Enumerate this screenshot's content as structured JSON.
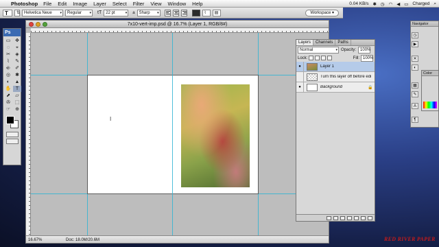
{
  "menubar": {
    "apple": "",
    "app_name": "Photoshop",
    "items": [
      "File",
      "Edit",
      "Image",
      "Layer",
      "Select",
      "Filter",
      "View",
      "Window",
      "Help"
    ],
    "battery_values": "0.04 KB/s",
    "charged": "Charged"
  },
  "options_bar": {
    "tool_glyph": "T",
    "font_family": "Helvetica Neue",
    "font_style": "Regular",
    "font_size": "22 pt",
    "aa_label": "a",
    "antialias": "Sharp",
    "workspace": "Workspace"
  },
  "tools": {
    "header": "Ps",
    "glyphs": [
      "▭",
      "✥",
      "◌",
      "⌖",
      "✂",
      "◈",
      "⌇",
      "✎",
      "⎆",
      "✐",
      "◎",
      "✱",
      "◐",
      "▲",
      "✋",
      "⬚",
      "T",
      "⬈",
      "▱",
      "✇",
      "☞",
      "⊕"
    ]
  },
  "document": {
    "title": "7x10-vert-imp.psd @ 16.7% (Layer 1, RGB/8#)",
    "zoom": "16.67%",
    "doc_size": "Doc: 18.0M/20.6M"
  },
  "layers_panel": {
    "tabs": [
      "Layers",
      "Channels",
      "Paths"
    ],
    "blend_mode": "Normal",
    "opacity_label": "Opacity:",
    "opacity_value": "100%",
    "lock_label": "Lock:",
    "fill_label": "Fill:",
    "fill_value": "100%",
    "layers": [
      {
        "name": "Layer 1",
        "visible_glyph": "●"
      },
      {
        "name": "Turn this layer off before edi",
        "visible_glyph": ""
      },
      {
        "name": "Background",
        "visible_glyph": "●"
      }
    ]
  },
  "right_panels": {
    "navigator": "Navigator",
    "color": "Color"
  },
  "watermark": "RED RIVER PAPER"
}
